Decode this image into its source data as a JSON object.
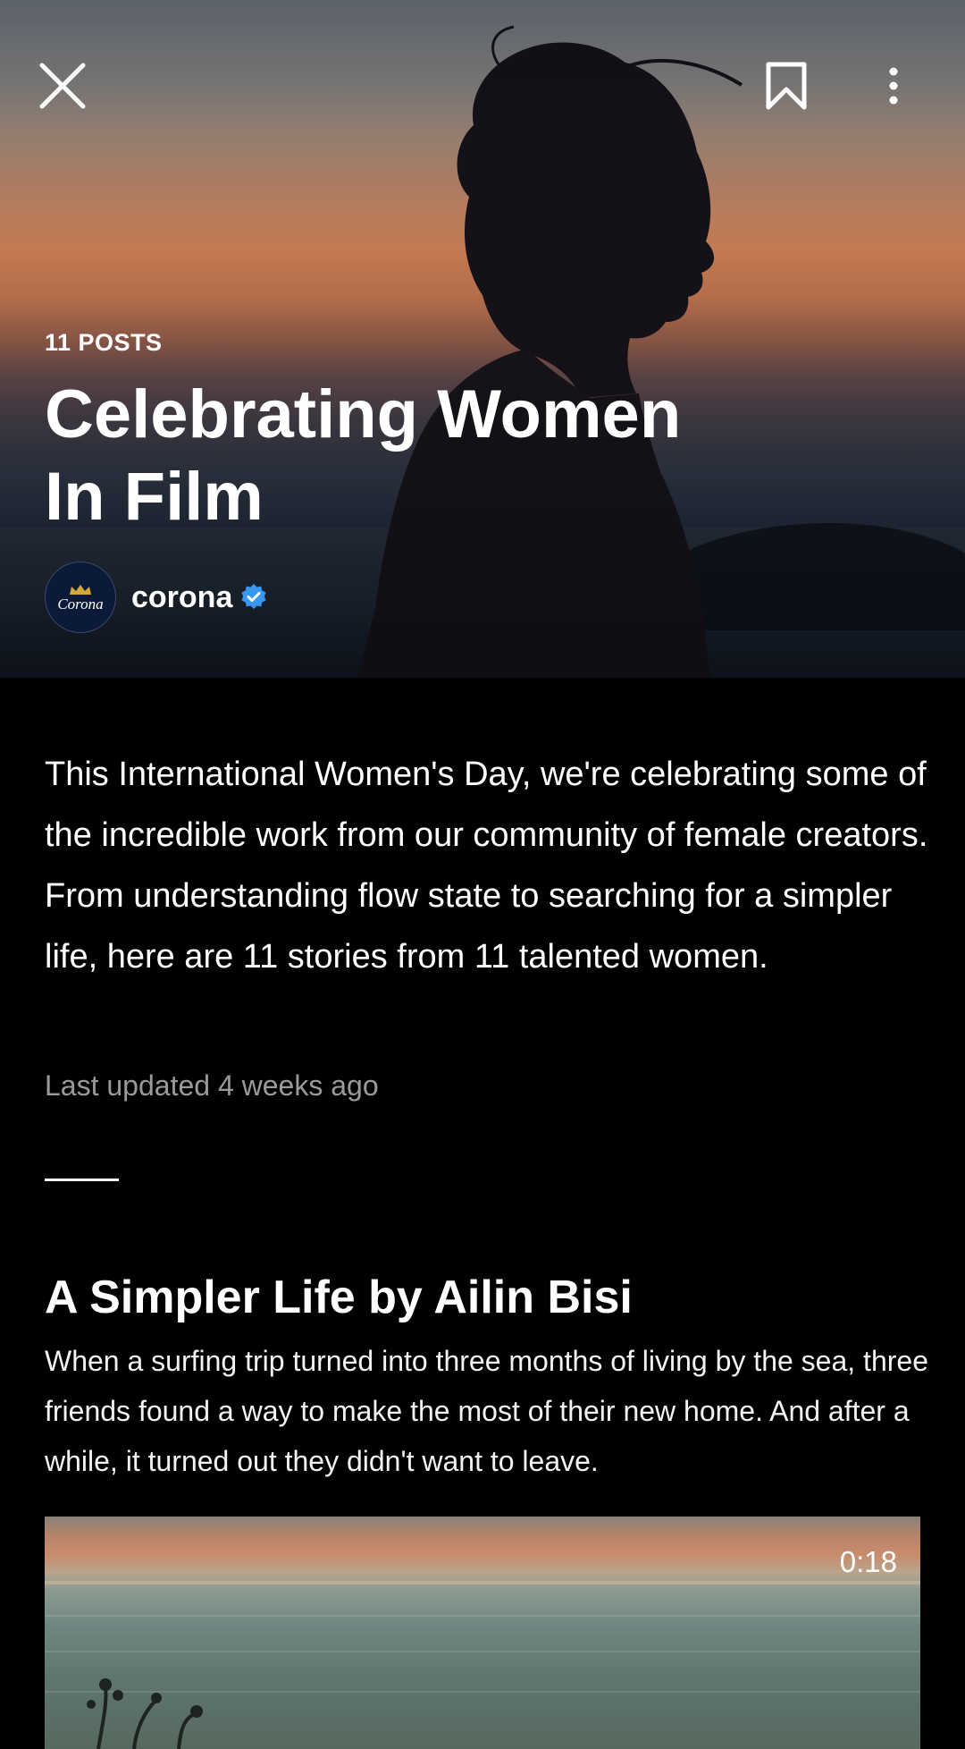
{
  "header": {
    "close_icon": "close-icon",
    "bookmark_icon": "bookmark-icon",
    "more_icon": "more-vertical-icon"
  },
  "collection": {
    "posts_count": "11 POSTS",
    "title_line1": "Celebrating Women",
    "title_line2": "In Film",
    "author": {
      "avatar_brand": "Corona",
      "name": "corona",
      "verified_color": "#3897f0"
    },
    "description": "This International Women's Day, we're celebrating some of the incredible work from our community of female creators. From understanding flow state to searching for a simpler life, here are 11 stories from 11 talented women.",
    "last_updated": "Last updated 4 weeks ago"
  },
  "story": {
    "title": "A Simpler Life by Ailin Bisi",
    "description": "When a surfing trip turned into three months of living by the sea, three friends found a way to make the most of their new home. And after a while, it turned out they didn't want to leave.",
    "video_duration": "0:18"
  }
}
